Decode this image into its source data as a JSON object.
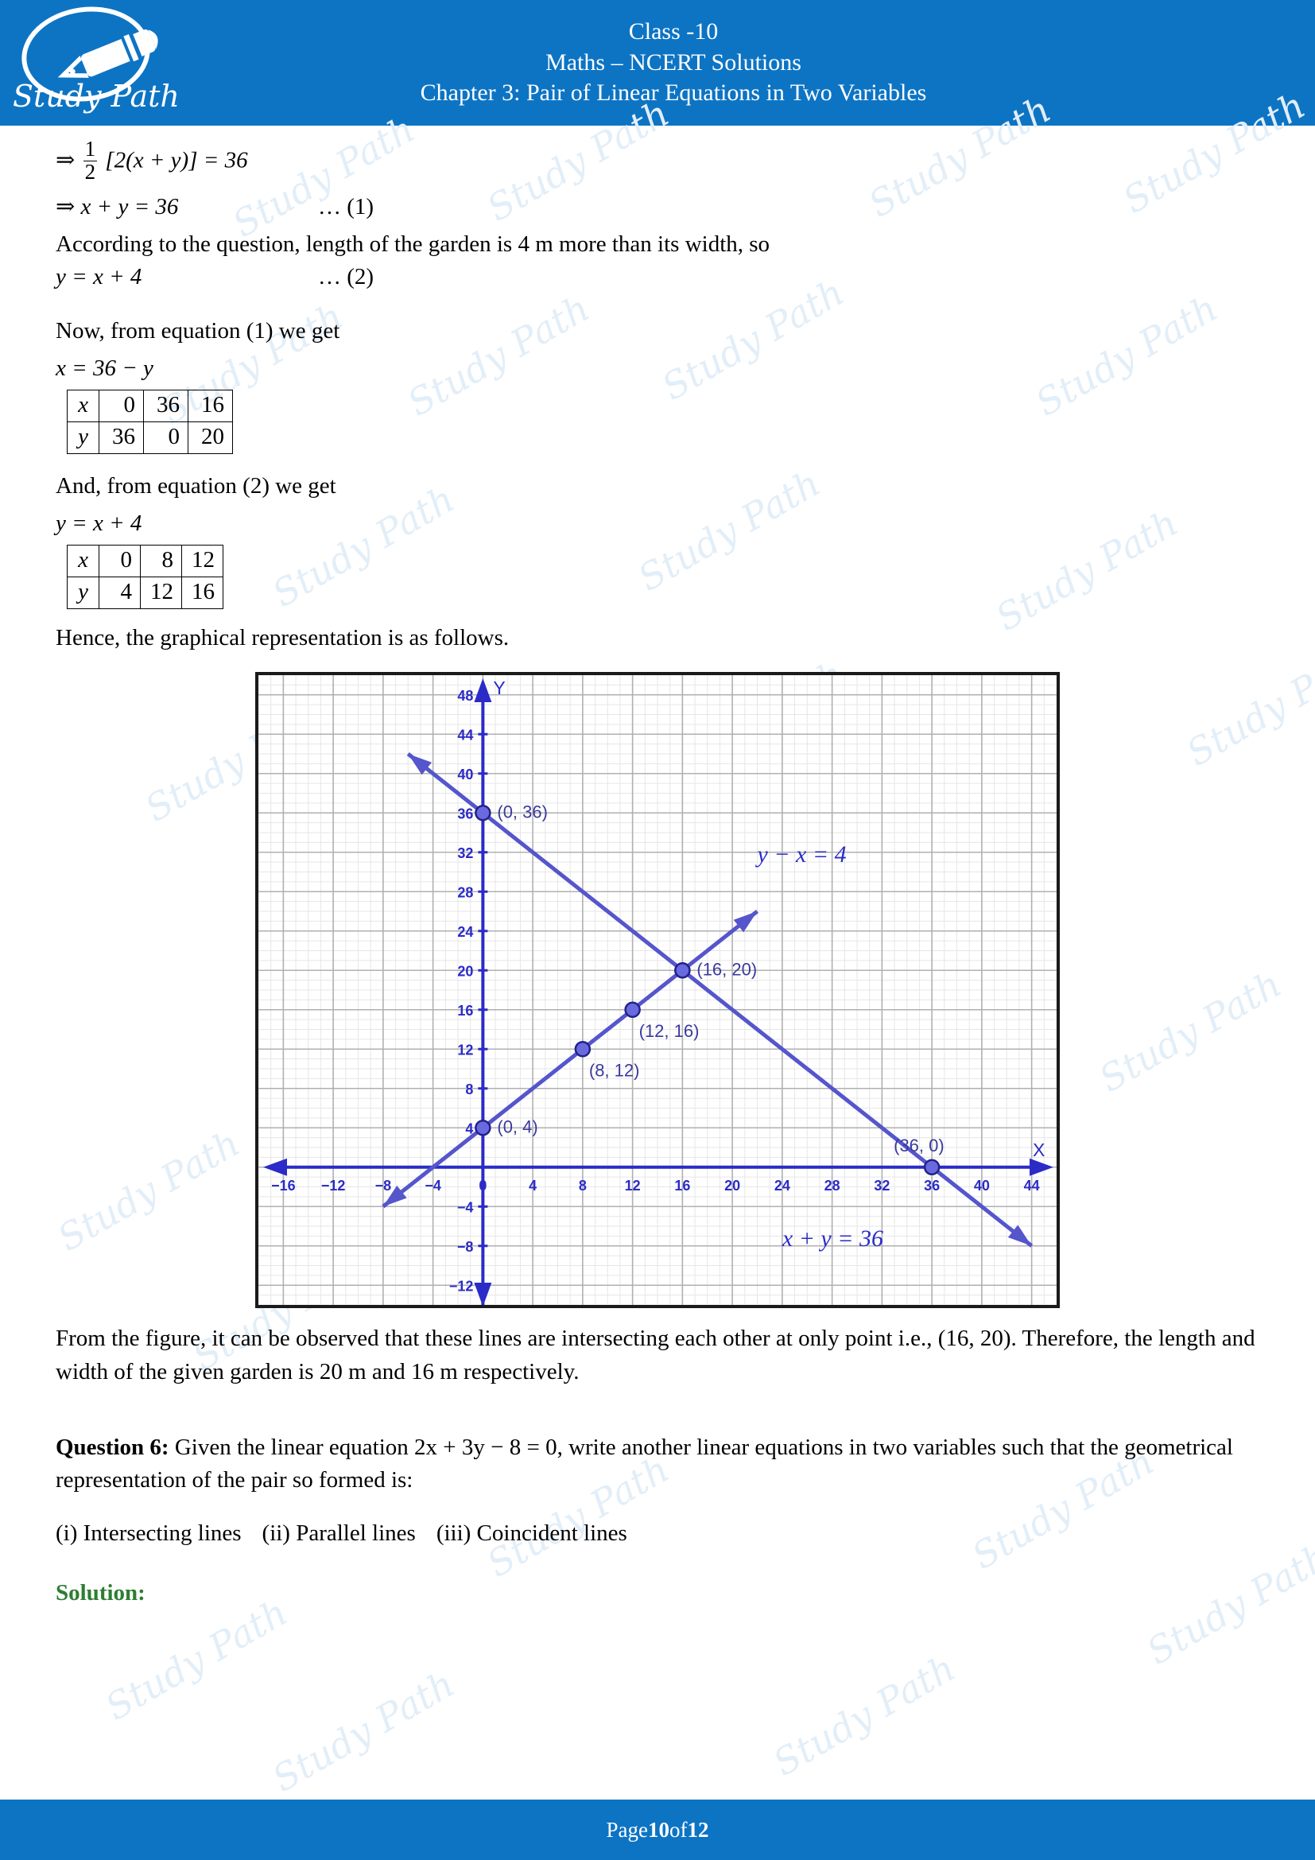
{
  "header": {
    "logo_text": "Study Path",
    "logo_icon": "fountain-pen-icon",
    "line1": "Class -10",
    "line2": "Maths – NCERT Solutions",
    "line3": "Chapter 3: Pair of Linear Equations in Two Variables"
  },
  "body": {
    "eq_half_lhs_arrow": "⇒",
    "eq_half_num": "1",
    "eq_half_den": "2",
    "eq_half_rest": "[2(x + y)] = 36",
    "eq1_text": "⇒ x + y = 36",
    "eq1_tag": "… (1)",
    "para_according": "According to the question, length of the garden is 4 m more than its width, so",
    "eq2_text": "y = x + 4",
    "eq2_tag": "… (2)",
    "now_from_eq1": "Now, from equation (1) we get",
    "x_expr": "x = 36 − y",
    "and_from_eq2": "And, from equation (2) we get",
    "y_expr": "y = x + 4",
    "hence_text": "Hence, the graphical representation is as follows.",
    "from_figure_text": "From the figure, it can be observed that these lines are intersecting each other at only point i.e., (16, 20). Therefore, the length and width of the given garden is 20 m and 16 m respectively.",
    "question_label": "Question 6:",
    "question_text": "Given the linear equation 2x + 3y − 8 = 0, write another linear equations in two variables such that the geometrical representation of the pair so formed is:",
    "choices": [
      "(i) Intersecting lines",
      "(ii) Parallel lines",
      "(iii) Coincident lines"
    ],
    "solution_label": "Solution:"
  },
  "table1": {
    "rows": [
      {
        "label": "x",
        "values": [
          "0",
          "36",
          "16"
        ]
      },
      {
        "label": "y",
        "values": [
          "36",
          "0",
          "20"
        ]
      }
    ]
  },
  "table2": {
    "rows": [
      {
        "label": "x",
        "values": [
          "0",
          "8",
          "12"
        ]
      },
      {
        "label": "y",
        "values": [
          "4",
          "12",
          "16"
        ]
      }
    ]
  },
  "chart_data": {
    "type": "line",
    "title": "",
    "xlabel": "X",
    "ylabel": "Y",
    "xlim": [
      -18,
      46
    ],
    "ylim": [
      -14,
      50
    ],
    "xticks": [
      -16,
      -12,
      -8,
      -4,
      0,
      4,
      8,
      12,
      16,
      20,
      24,
      28,
      32,
      36,
      40,
      44
    ],
    "yticks": [
      -12,
      -8,
      -4,
      4,
      8,
      12,
      16,
      20,
      24,
      28,
      32,
      36,
      40,
      44,
      48
    ],
    "grid": true,
    "grid_minor": true,
    "axis_color": "#2b2bc8",
    "line_color": "#5555cc",
    "label_color": "#3a3a9e",
    "series": [
      {
        "name": "x + y = 36",
        "equation_label": "x + y = 36",
        "label_x": 24,
        "label_y": -8,
        "from": {
          "x": -6,
          "y": 42
        },
        "to": {
          "x": 44,
          "y": -8
        },
        "points": [
          {
            "x": 0,
            "y": 36,
            "label": "(0, 36)"
          },
          {
            "x": 16,
            "y": 20,
            "label": "(16, 20)"
          },
          {
            "x": 36,
            "y": 0,
            "label": "(36, 0)"
          }
        ]
      },
      {
        "name": "y − x = 4",
        "equation_label": "y − x = 4",
        "label_x": 22,
        "label_y": 31,
        "from": {
          "x": -8,
          "y": -4
        },
        "to": {
          "x": 22,
          "y": 26
        },
        "points": [
          {
            "x": 0,
            "y": 4,
            "label": "(0, 4)"
          },
          {
            "x": 8,
            "y": 12,
            "label": "(8, 12)"
          },
          {
            "x": 12,
            "y": 16,
            "label": "(12, 16)"
          },
          {
            "x": 16,
            "y": 20,
            "label": "(16, 20)"
          }
        ]
      }
    ],
    "intersection": {
      "x": 16,
      "y": 20,
      "label": "(16, 20)"
    }
  },
  "footer": {
    "prefix": "Page ",
    "page": "10",
    "middle": " of ",
    "total": "12"
  },
  "watermark": {
    "text": "Study Path"
  },
  "colors": {
    "header_bg": "#0d74c4",
    "footer_bg": "#0d74c4",
    "solution_green": "#2e7d32",
    "graph_blue": "#2b2bc8",
    "line_blue": "#5555cc",
    "watermark": "#e2eef8"
  }
}
